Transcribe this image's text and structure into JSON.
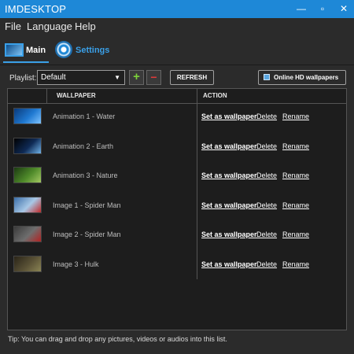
{
  "window": {
    "title": "IMDESKTOP"
  },
  "window_controls": {
    "minimize": "—",
    "maximize": "▫",
    "close": "✕"
  },
  "menu": {
    "items": [
      "File",
      "Language",
      "Help"
    ]
  },
  "tabs": [
    {
      "label": "Main",
      "active": true
    },
    {
      "label": "Settings",
      "active": false
    }
  ],
  "toolbar": {
    "playlist_label": "Playlist:",
    "playlist_value": "Default",
    "add_symbol": "+",
    "remove_symbol": "−",
    "refresh_label": "REFRESH",
    "online_label": "Online HD wallpapers"
  },
  "table": {
    "columns": [
      "",
      "WALLPAPER",
      "ACTION"
    ],
    "actions": {
      "set": "Set as wallpaper",
      "delete": "Delete",
      "rename": "Rename"
    },
    "rows": [
      {
        "name": "Animation 1 - Water",
        "thumb_colors": [
          "#0a3a7a",
          "#1f78d0",
          "#7ec3ff"
        ]
      },
      {
        "name": "Animation 2 - Earth",
        "thumb_colors": [
          "#000000",
          "#0f2a55",
          "#6fb2e8"
        ]
      },
      {
        "name": "Animation 3 - Nature",
        "thumb_colors": [
          "#1c3a12",
          "#4f8a2a",
          "#a3c862"
        ]
      },
      {
        "name": "Image 1 - Spider Man",
        "thumb_colors": [
          "#3b6ea8",
          "#a8c8e6",
          "#c02a2a"
        ]
      },
      {
        "name": "Image 2 - Spider Man",
        "thumb_colors": [
          "#3a3a3a",
          "#6e6e6e",
          "#b22222"
        ]
      },
      {
        "name": "Image 3 - Hulk",
        "thumb_colors": [
          "#2a2418",
          "#5a5236",
          "#8a8454"
        ]
      }
    ]
  },
  "tip": "Tip: You can drag and drop any pictures, videos or audios into this list.",
  "colors": {
    "accent": "#1e88d7",
    "background": "#2b2b2b",
    "list_background": "#1d1d1d"
  }
}
